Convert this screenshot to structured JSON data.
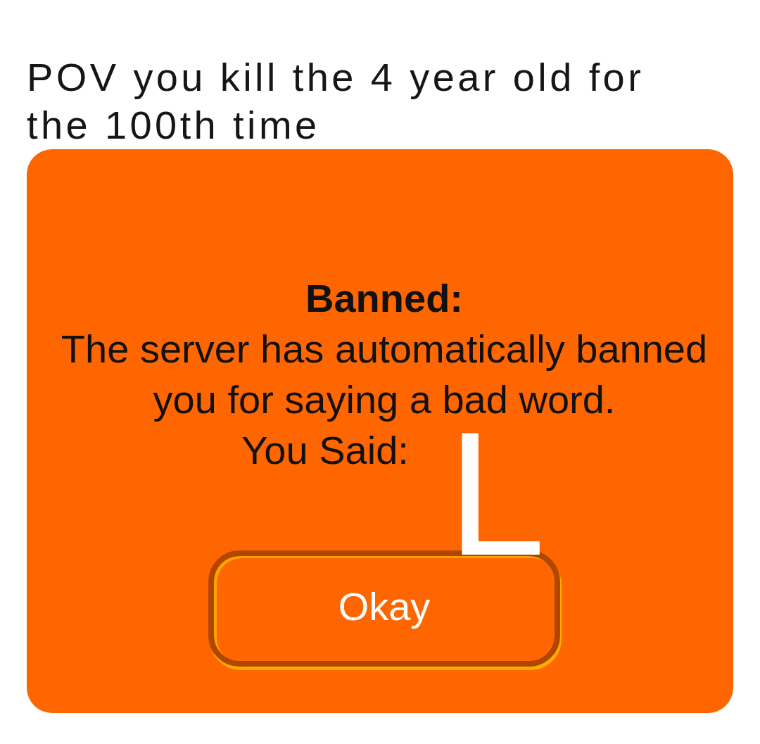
{
  "caption": "POV you kill the 4 year old for the 100th time",
  "dialog": {
    "title": "Banned:",
    "message": "The server has automatically banned you for saying a bad word.",
    "prompt": "You Said:",
    "said_word": "L",
    "button": "Okay"
  }
}
